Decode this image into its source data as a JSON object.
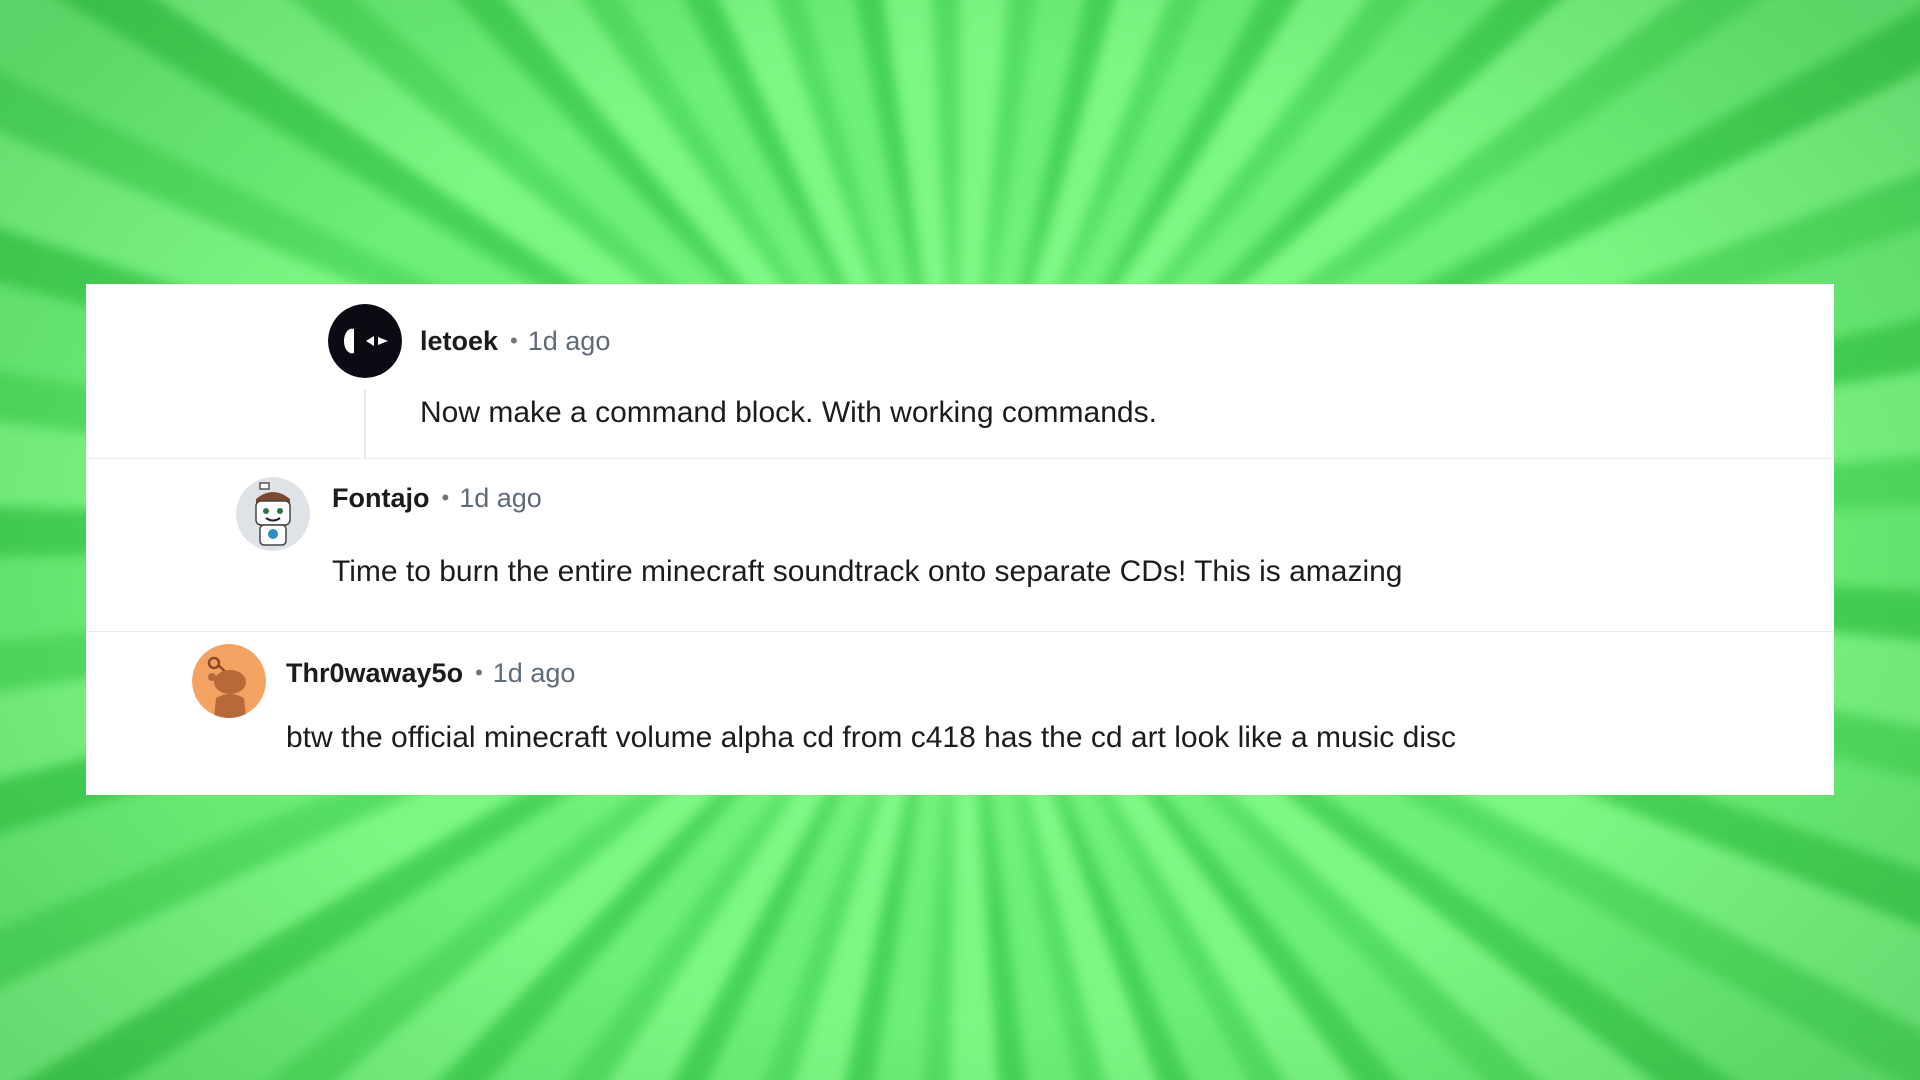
{
  "comments": [
    {
      "username": "letoek",
      "separator": "•",
      "time": "1d ago",
      "text": "Now make a command block. With working commands.",
      "avatar_icon": "dark-eyes-avatar-icon"
    },
    {
      "username": "Fontajo",
      "separator": "•",
      "time": "1d ago",
      "text": "Time to burn the entire minecraft soundtrack onto separate CDs! This is amazing",
      "avatar_icon": "snoo-robot-avatar-icon"
    },
    {
      "username": "Thr0waway5o",
      "separator": "•",
      "time": "1d ago",
      "text": "btw the official minecraft volume alpha cd from c418 has the cd art look like a music disc",
      "avatar_icon": "snoo-default-avatar-icon"
    }
  ],
  "colors": {
    "background_green": "#62e86f",
    "card": "#ffffff",
    "username": "#1c1c1c",
    "timestamp": "#5f6b76",
    "default_avatar": "#f4a261"
  }
}
